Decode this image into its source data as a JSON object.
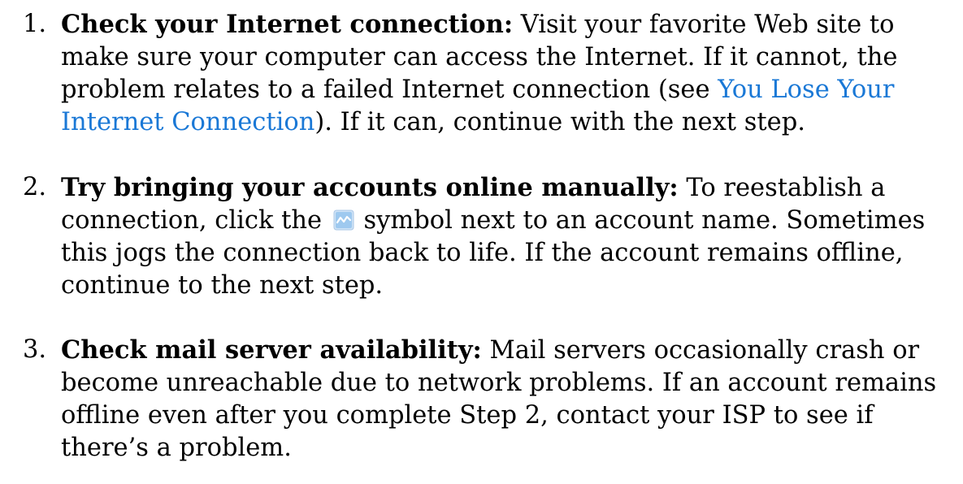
{
  "steps": [
    {
      "number": "1.",
      "heading": "Check your Internet connection:",
      "text_before_link": " Visit your favorite Web site to make sure your computer can access the Internet. If it cannot, the problem relates to a failed Internet connection (see ",
      "link_text": "You Lose Your Internet Connection",
      "text_after_link": "). If it can, continue with the next step."
    },
    {
      "number": "2.",
      "heading": "Try bringing your accounts online manually:",
      "text_before_icon": " To reestablish a connection, click the ",
      "icon": "connection-sync-icon",
      "text_after_icon": " symbol next to an account name. Sometimes this jogs the connection back to life. If the account remains offline, continue to the next step."
    },
    {
      "number": "3.",
      "heading": "Check mail server availability:",
      "text": " Mail servers occasionally crash or become unreachable due to network problems. If an account remains offline even after you complete Step 2, contact your ISP to see if there’s a problem."
    }
  ],
  "colors": {
    "link": "#1a78d6",
    "text": "#000000",
    "icon_fill": "#9ec9ef"
  }
}
